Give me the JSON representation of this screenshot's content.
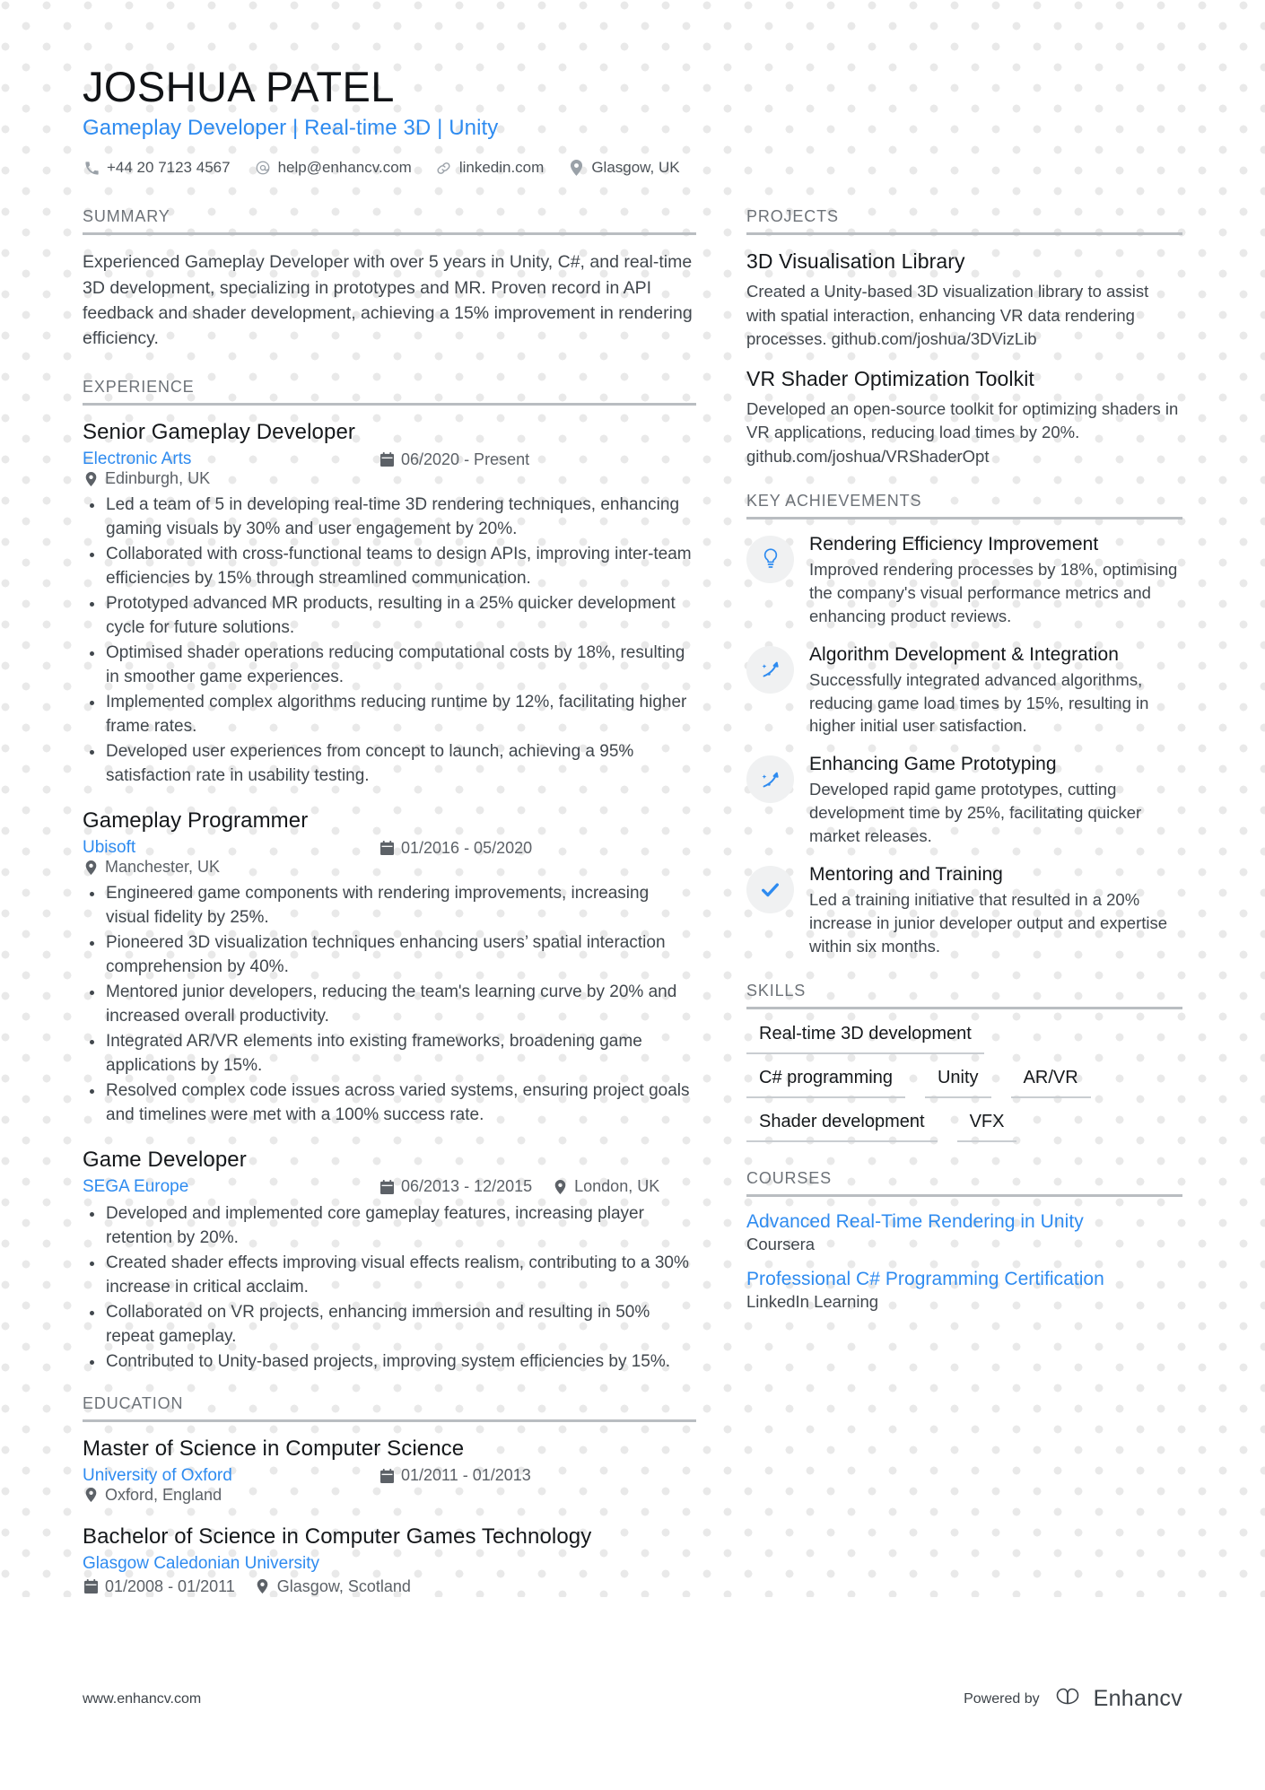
{
  "colors": {
    "accent": "#2e8bf0",
    "heading": "#15181b",
    "body": "#41474d",
    "muted": "#6d7278",
    "rule": "#b9bdc1",
    "icon_bubble": "#f0f1f2",
    "dot_pattern": "#e9e9e9"
  },
  "header": {
    "name": "JOSHUA PATEL",
    "headline": "Gameplay Developer | Real-time 3D | Unity",
    "contacts": [
      {
        "icon": "phone-icon",
        "text": "+44 20 7123 4567"
      },
      {
        "icon": "email-icon",
        "text": "help@enhancv.com"
      },
      {
        "icon": "link-icon",
        "text": "linkedin.com"
      },
      {
        "icon": "location-pin-icon",
        "text": "Glasgow, UK"
      }
    ]
  },
  "summary": {
    "title": "SUMMARY",
    "text": "Experienced Gameplay Developer with over 5 years in Unity, C#, and real-time 3D development, specializing in prototypes and MR. Proven record in API feedback and shader development, achieving a 15% improvement in rendering efficiency."
  },
  "experience": {
    "title": "EXPERIENCE",
    "items": [
      {
        "role": "Senior Gameplay Developer",
        "company": "Electronic Arts",
        "dates": "06/2020 - Present",
        "location": "Edinburgh, UK",
        "bullets": [
          "Led a team of 5 in developing real-time 3D rendering techniques, enhancing gaming visuals by 30% and user engagement by 20%.",
          "Collaborated with cross-functional teams to design APIs, improving inter-team efficiencies by 15% through streamlined communication.",
          "Prototyped advanced MR products, resulting in a 25% quicker development cycle for future solutions.",
          "Optimised shader operations reducing computational costs by 18%, resulting in smoother game experiences.",
          "Implemented complex algorithms reducing runtime by 12%, facilitating higher frame rates.",
          "Developed user experiences from concept to launch, achieving a 95% satisfaction rate in usability testing."
        ]
      },
      {
        "role": "Gameplay Programmer",
        "company": "Ubisoft",
        "dates": "01/2016 - 05/2020",
        "location": "Manchester, UK",
        "bullets": [
          "Engineered game components with rendering improvements, increasing visual fidelity by 25%.",
          "Pioneered 3D visualization techniques enhancing users’ spatial interaction comprehension by 40%.",
          "Mentored junior developers, reducing the team's learning curve by 20% and increased overall productivity.",
          "Integrated AR/VR elements into existing frameworks, broadening game applications by 15%.",
          "Resolved complex code issues across varied systems, ensuring project goals and timelines were met with a 100% success rate."
        ]
      },
      {
        "role": "Game Developer",
        "company": "SEGA Europe",
        "dates": "06/2013 - 12/2015",
        "location": "London, UK",
        "bullets": [
          "Developed and implemented core gameplay features, increasing player retention by 20%.",
          "Created shader effects improving visual effects realism, contributing to a 30% increase in critical acclaim.",
          "Collaborated on VR projects, enhancing immersion and resulting in 50% repeat gameplay.",
          "Contributed to Unity-based projects, improving system efficiencies by 15%."
        ]
      }
    ]
  },
  "education": {
    "title": "EDUCATION",
    "items": [
      {
        "degree": "Master of Science in Computer Science",
        "school": "University of Oxford",
        "dates": "01/2011 - 01/2013",
        "location": "Oxford, England",
        "wrapped": false
      },
      {
        "degree": "Bachelor of Science in Computer Games Technology",
        "school": "Glasgow Caledonian University",
        "dates": "01/2008 - 01/2011",
        "location": "Glasgow, Scotland",
        "wrapped": true
      }
    ]
  },
  "projects": {
    "title": "PROJECTS",
    "items": [
      {
        "name": "3D Visualisation Library",
        "description": "Created a Unity-based 3D visualization library to assist with spatial interaction, enhancing VR data rendering processes. github.com/joshua/3DVizLib"
      },
      {
        "name": "VR Shader Optimization Toolkit",
        "description": "Developed an open-source toolkit for optimizing shaders in VR applications, reducing load times by 20%. github.com/joshua/VRShaderOpt"
      }
    ]
  },
  "key_achievements": {
    "title": "KEY ACHIEVEMENTS",
    "items": [
      {
        "icon": "lightbulb-icon",
        "name": "Rendering Efficiency Improvement",
        "text": "Improved rendering processes by 18%, optimising the company's visual performance metrics and enhancing product reviews."
      },
      {
        "icon": "magic-wand-icon",
        "name": "Algorithm Development & Integration",
        "text": "Successfully integrated advanced algorithms, reducing game load times by 15%, resulting in higher initial user satisfaction."
      },
      {
        "icon": "magic-wand-icon",
        "name": "Enhancing Game Prototyping",
        "text": "Developed rapid game prototypes, cutting development time by 25%, facilitating quicker market releases."
      },
      {
        "icon": "check-icon",
        "name": "Mentoring and Training",
        "text": "Led a training initiative that resulted in a 20% increase in junior developer output and expertise within six months."
      }
    ]
  },
  "skills": {
    "title": "SKILLS",
    "rows": [
      [
        "Real-time 3D development"
      ],
      [
        "C# programming",
        "Unity",
        "AR/VR"
      ],
      [
        "Shader development",
        "VFX"
      ]
    ]
  },
  "courses": {
    "title": "COURSES",
    "items": [
      {
        "name": "Advanced Real-Time Rendering in Unity",
        "provider": "Coursera"
      },
      {
        "name": "Professional C# Programming Certification",
        "provider": "LinkedIn Learning"
      }
    ]
  },
  "footer": {
    "url": "www.enhancv.com",
    "powered_by": "Powered by",
    "brand": "Enhancv"
  }
}
